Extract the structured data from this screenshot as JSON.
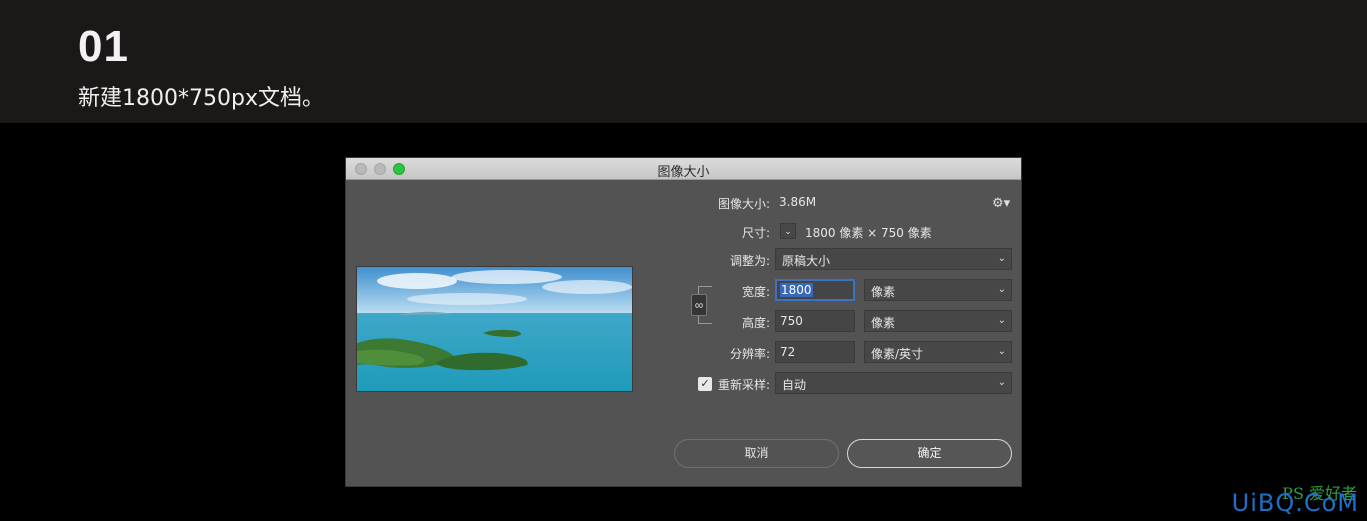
{
  "banner": {
    "step": "01",
    "description": "新建1800*750px文档。"
  },
  "dialog": {
    "title": "图像大小",
    "image_size_label": "图像大小:",
    "image_size_value": "3.86M",
    "dimensions_label": "尺寸:",
    "dimensions_value": "1800 像素 × 750 像素",
    "fit_to_label": "调整为:",
    "fit_to_value": "原稿大小",
    "width_label": "宽度:",
    "width_value": "1800",
    "width_unit": "像素",
    "height_label": "高度:",
    "height_value": "750",
    "height_unit": "像素",
    "resolution_label": "分辨率:",
    "resolution_value": "72",
    "resolution_unit": "像素/英寸",
    "resample_label": "重新采样:",
    "resample_value": "自动",
    "cancel_label": "取消",
    "ok_label": "确定"
  },
  "watermark": {
    "text": "UiBQ.CoM",
    "sub": "PS 爱好者"
  }
}
